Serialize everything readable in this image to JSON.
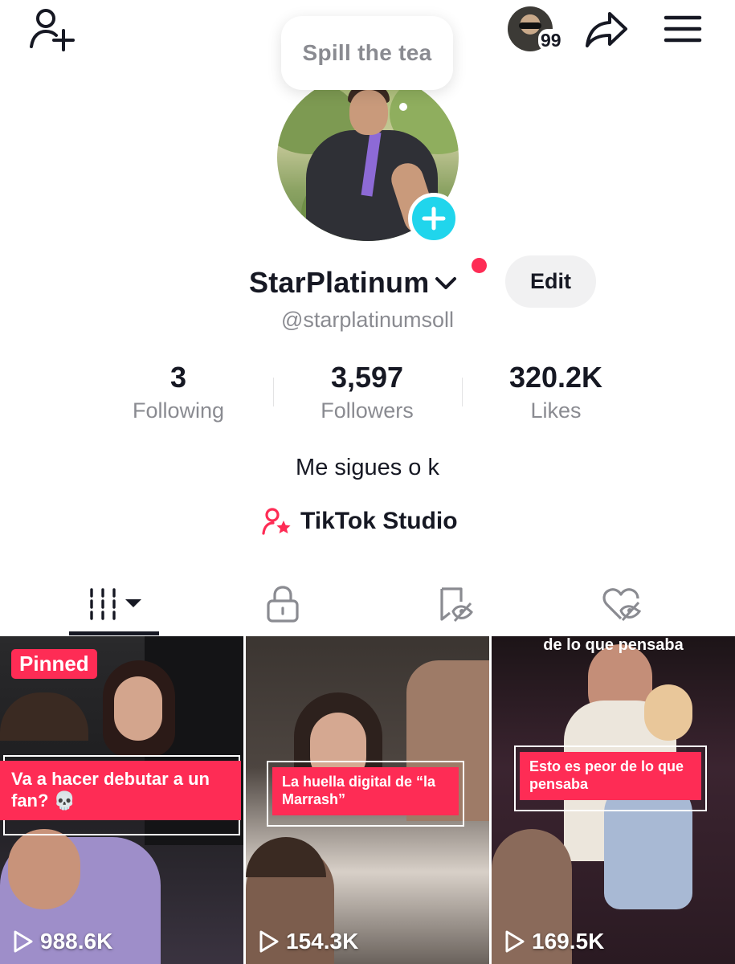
{
  "header": {
    "add_friend_icon": "person-plus-icon",
    "notification_count": "99",
    "share_icon": "share-arrow-icon",
    "menu_icon": "hamburger-icon"
  },
  "bubble": {
    "text": "Spill the tea"
  },
  "profile": {
    "username": "StarPlatinum",
    "handle": "@starplatinumsoll",
    "edit_label": "Edit",
    "bio": "Me sigues o k",
    "studio_label": "TikTok Studio"
  },
  "stats": [
    {
      "value": "3",
      "label": "Following"
    },
    {
      "value": "3,597",
      "label": "Followers"
    },
    {
      "value": "320.2K",
      "label": "Likes"
    }
  ],
  "tabs": [
    {
      "icon": "videos-grid-icon",
      "active": true
    },
    {
      "icon": "lock-icon",
      "active": false
    },
    {
      "icon": "favorites-hidden-icon",
      "active": false
    },
    {
      "icon": "liked-hidden-icon",
      "active": false
    }
  ],
  "videos": [
    {
      "pinned_label": "Pinned",
      "caption": "Va a hacer debutar a un fan? 💀",
      "views": "988.6K",
      "top_text": ""
    },
    {
      "pinned_label": "",
      "caption": "La huella digital de “la Marrash”",
      "views": "154.3K",
      "top_text": ""
    },
    {
      "pinned_label": "",
      "caption": "Esto es peor de lo que pensaba",
      "views": "169.5K",
      "top_text": "de lo que pensaba"
    }
  ],
  "colors": {
    "accent": "#fe2c55",
    "cyan": "#20d5ec",
    "muted": "#8a8b91",
    "text": "#161823"
  }
}
